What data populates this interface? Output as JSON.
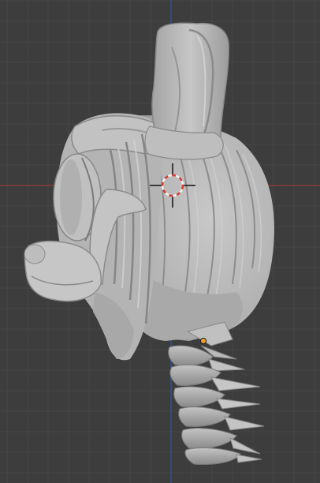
{
  "viewport": {
    "background_color": "#3d3d3d",
    "grid_color": "#454545",
    "x_axis_color": "#8a3a3a",
    "y_axis_color": "#35508f"
  },
  "model": {
    "base_color": "#b7b7b7",
    "shadow_color": "#8c8c8c",
    "dark_color": "#6e6e6e",
    "highlight_color": "#d2d2d2"
  },
  "cursor_3d": {
    "ring_red": "#d33a2e",
    "ring_white": "#f2f2f2",
    "crosshair_color": "#111111"
  },
  "origin_point": {
    "color": "#f0a030",
    "outline": "#1a1a1a"
  }
}
